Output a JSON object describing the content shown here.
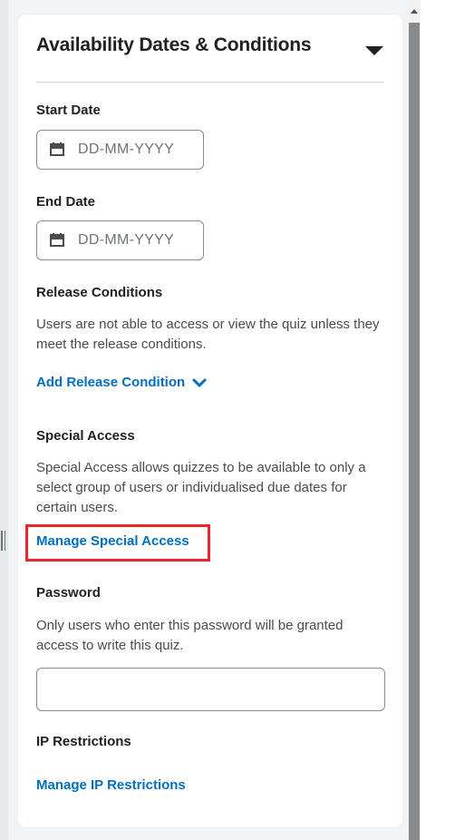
{
  "header": {
    "title": "Availability Dates & Conditions",
    "collapse_icon": "caret-down-icon"
  },
  "start_date": {
    "label": "Start Date",
    "placeholder": "DD-MM-YYYY",
    "icon": "calendar-icon"
  },
  "end_date": {
    "label": "End Date",
    "placeholder": "DD-MM-YYYY",
    "icon": "calendar-icon"
  },
  "release_conditions": {
    "label": "Release Conditions",
    "help": "Users are not able to access or view the quiz unless they meet the release conditions.",
    "add_link": "Add Release Condition",
    "add_icon": "chevron-down-icon"
  },
  "special_access": {
    "label": "Special Access",
    "help": "Special Access allows quizzes to be available to only a select group of users or individualised due dates for certain users.",
    "manage_link": "Manage Special Access"
  },
  "password": {
    "label": "Password",
    "help": "Only users who enter this password will be granted access to write this quiz.",
    "value": ""
  },
  "ip_restrictions": {
    "label": "IP Restrictions",
    "manage_link": "Manage IP Restrictions"
  },
  "colors": {
    "link": "#006fbf",
    "highlight": "#e8262b",
    "text": "#202122"
  }
}
